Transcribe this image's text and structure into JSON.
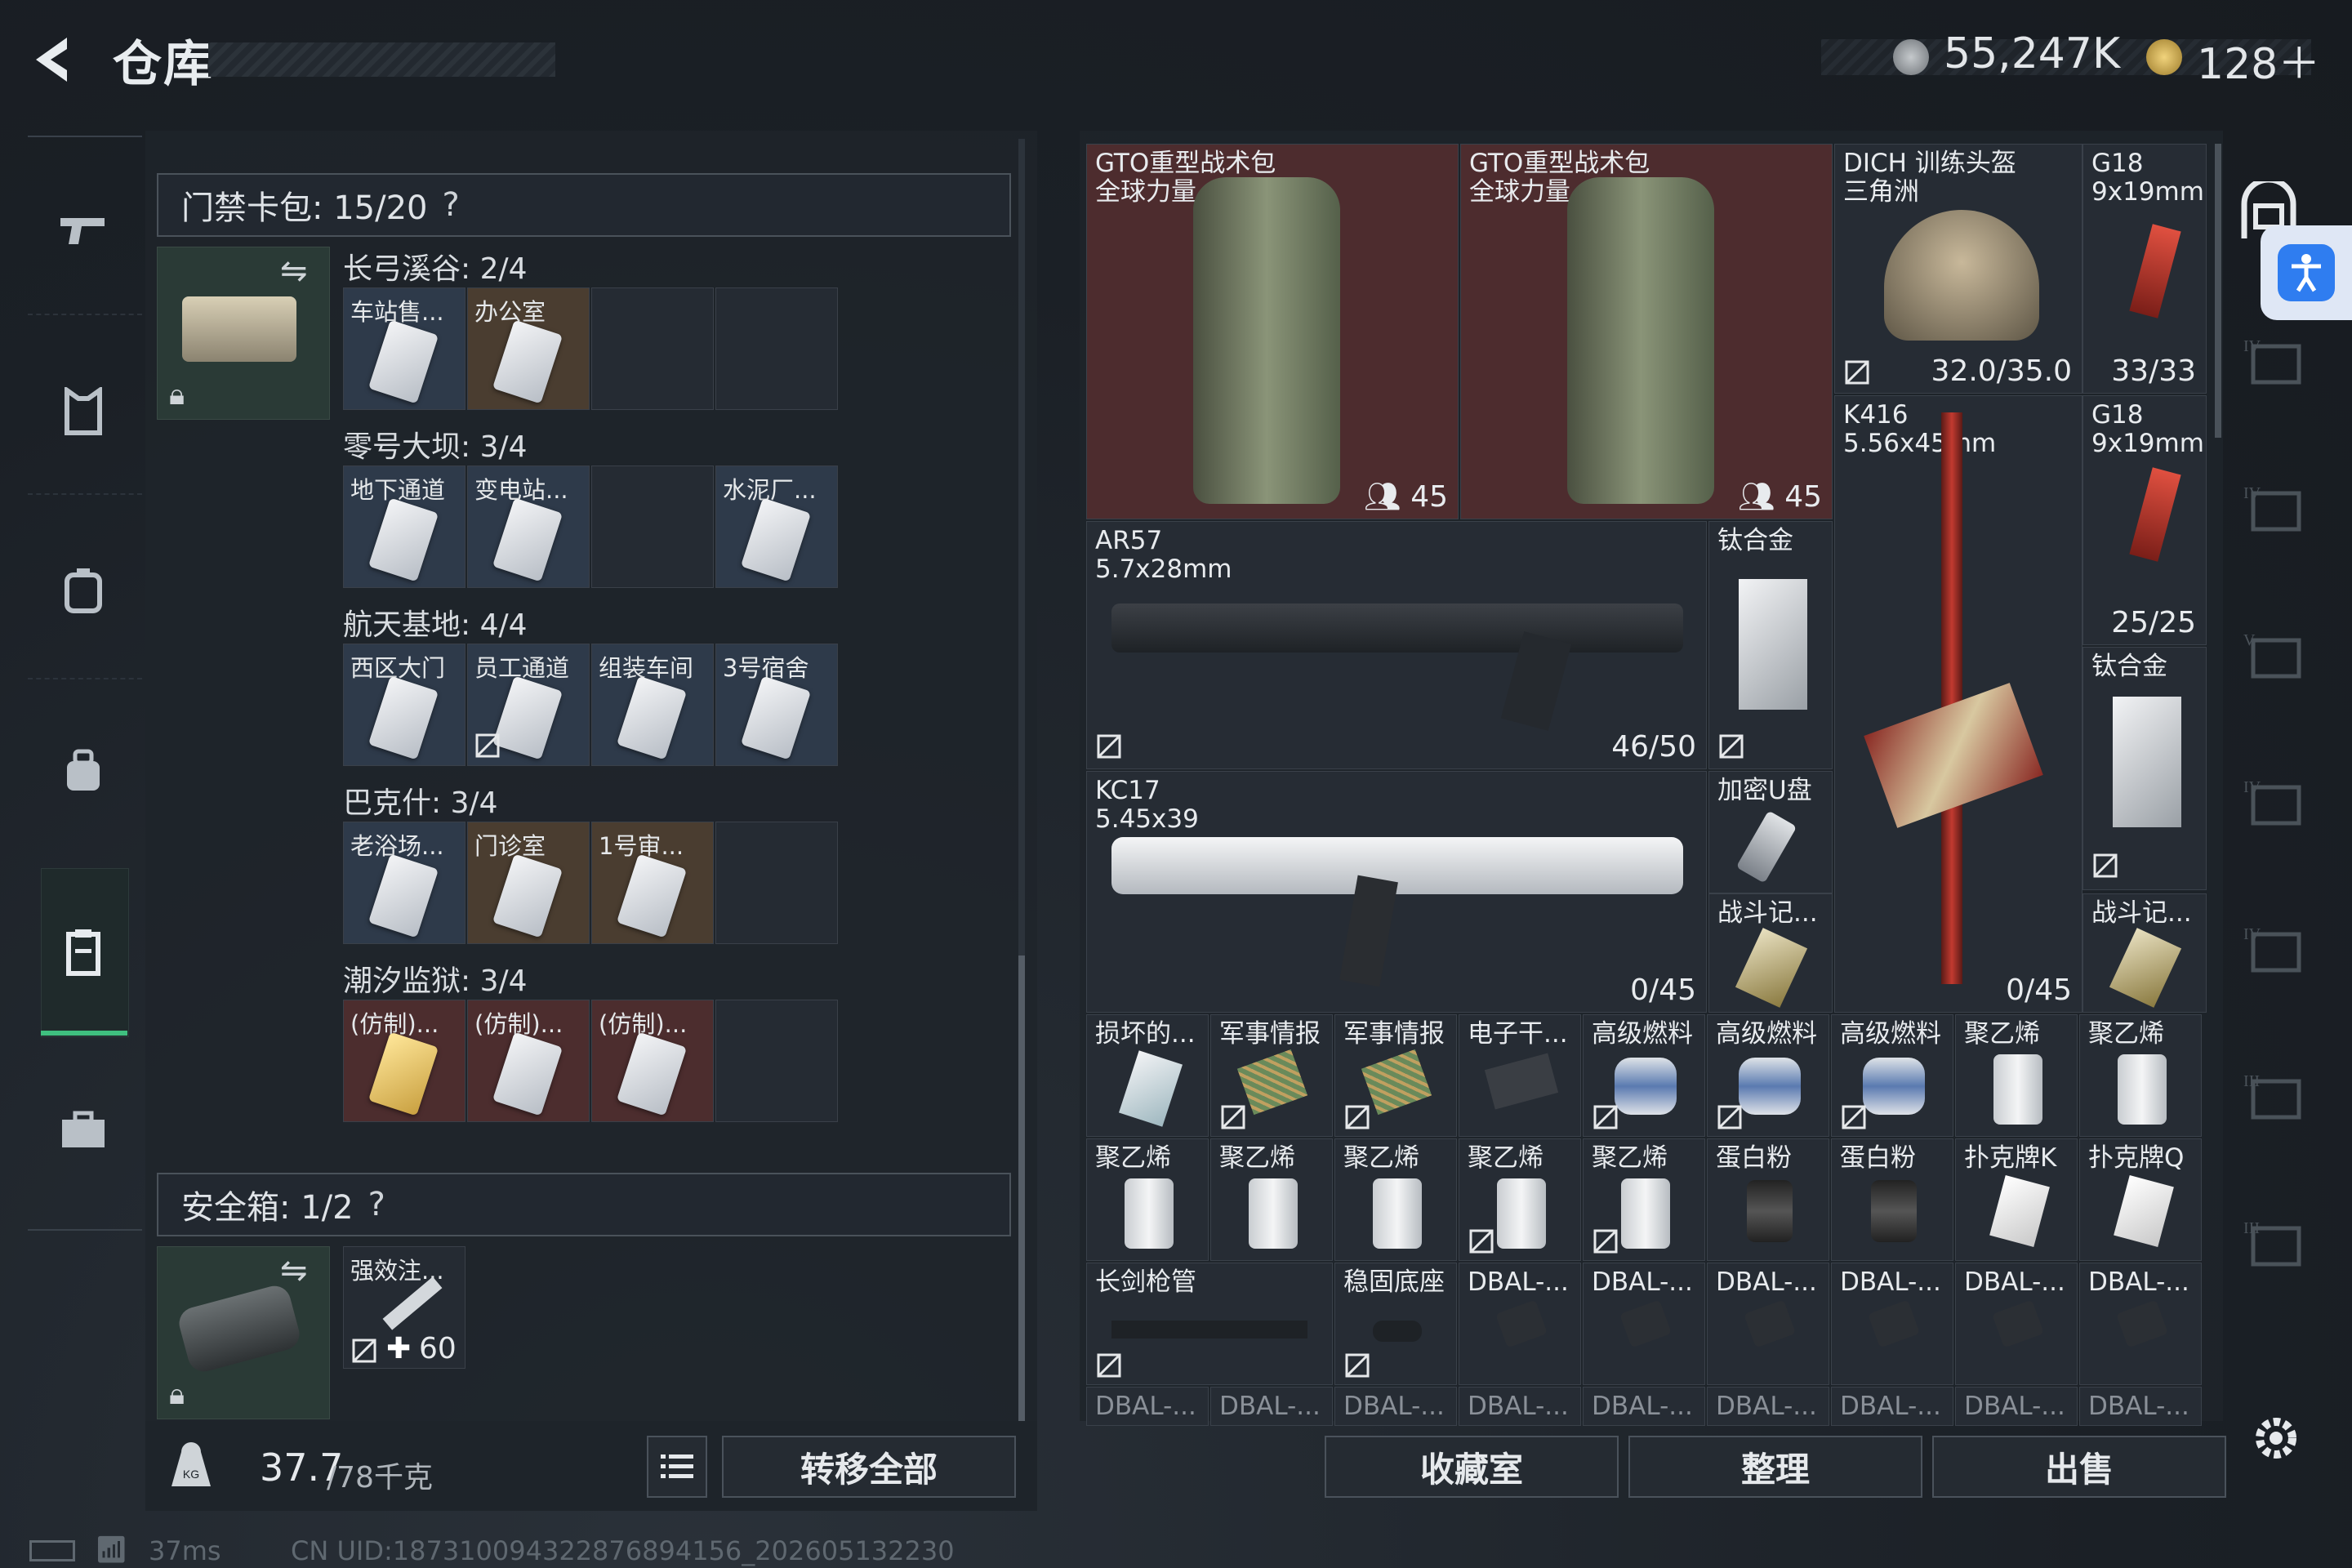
{
  "header": {
    "title": "仓库",
    "currency": "55,247K",
    "premium": "128＋"
  },
  "left": {
    "keycard_bar": "门禁卡包: 15/20",
    "help": "?",
    "groups": [
      {
        "label": "长弓溪谷: 2/4",
        "cards": [
          "车站售...",
          "办公室",
          "",
          ""
        ]
      },
      {
        "label": "零号大坝: 3/4",
        "cards": [
          "地下通道",
          "变电站...",
          "",
          "水泥厂..."
        ]
      },
      {
        "label": "航天基地: 4/4",
        "cards": [
          "西区大门",
          "员工通道",
          "组装车间",
          "3号宿舍"
        ]
      },
      {
        "label": "巴克什: 3/4",
        "cards": [
          "老浴场...",
          "门诊室",
          "1号审...",
          ""
        ]
      },
      {
        "label": "潮汐监狱: 3/4",
        "cards": [
          "(仿制)...",
          "(仿制)...",
          "(仿制)...",
          ""
        ]
      }
    ],
    "safe_bar": "安全箱: 1/2",
    "safe_item": {
      "label": "强效注...",
      "count": "60"
    },
    "weight": "37.7",
    "weight_max": "/78千克",
    "transfer_all": "转移全部"
  },
  "right": {
    "backpack1": {
      "label": "GTO重型战术包\n全球力量",
      "count": "45"
    },
    "backpack2": {
      "label": "GTO重型战术包\n全球力量",
      "count": "45"
    },
    "helmet": {
      "label": "DICH 训练头盔\n三角洲",
      "val": "32.0/35.0"
    },
    "g18a": {
      "label": "G18\n9x19mm",
      "val": "33/33"
    },
    "k416": {
      "label": "K416\n5.56x45mm",
      "val": "0/45"
    },
    "g18b": {
      "label": "G18\n9x19mm",
      "val": "25/25"
    },
    "ar57": {
      "label": "AR57\n5.7x28mm",
      "val": "46/50"
    },
    "ti1": {
      "label": "钛合金"
    },
    "ti2": {
      "label": "钛合金"
    },
    "kc17": {
      "label": "KC17\n5.45x39",
      "val": "0/45"
    },
    "usb": {
      "label": "加密U盘"
    },
    "rec1": {
      "label": "战斗记..."
    },
    "rec2": {
      "label": "战斗记..."
    },
    "row5": [
      "损坏的...",
      "军事情报",
      "军事情报",
      "电子干...",
      "高级燃料",
      "高级燃料",
      "高级燃料",
      "聚乙烯",
      "聚乙烯"
    ],
    "row6": [
      "聚乙烯",
      "聚乙烯",
      "聚乙烯",
      "聚乙烯",
      "聚乙烯",
      "蛋白粉",
      "蛋白粉",
      "扑克牌K",
      "扑克牌Q"
    ],
    "row7": [
      "长剑枪管",
      "稳固底座",
      "DBAL-...",
      "DBAL-...",
      "DBAL-...",
      "DBAL-...",
      "DBAL-...",
      "DBAL-..."
    ],
    "row8": [
      "DBAL-...",
      "DBAL-...",
      "DBAL-...",
      "DBAL-...",
      "DBAL-...",
      "DBAL-...",
      "DBAL-...",
      "DBAL-...",
      "DBAL-..."
    ],
    "btn_collection": "收藏室",
    "btn_sort": "整理",
    "btn_sell": "出售"
  },
  "status": {
    "ping": "37ms",
    "uid": "CN UID:187310094322876894156_202605132230"
  },
  "colors": {
    "accent": "#3fbf7f",
    "red_slot": "#4d2c2e",
    "assist": "#2f7df0"
  }
}
